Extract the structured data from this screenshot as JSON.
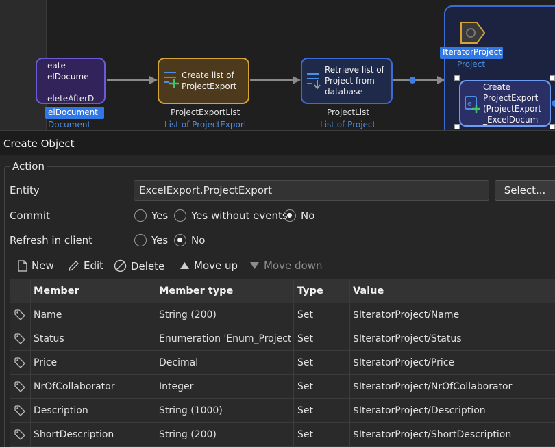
{
  "canvas": {
    "node_excel": {
      "text": "eate\nelDocume\n\neleteAfterD"
    },
    "excel_var": {
      "name": "elDocument",
      "type": "Document"
    },
    "node_create_list": {
      "text": "Create list of\nProjectExport"
    },
    "create_list_var": {
      "name": "ProjectExportList",
      "type": "List of ProjectExport"
    },
    "node_retrieve": {
      "text": "Retrieve list of\nProject from\ndatabase"
    },
    "retrieve_var": {
      "name": "ProjectList",
      "type": "List of Project"
    },
    "iterator": {
      "name": "IteratorProject",
      "type": "Project"
    },
    "node_create_obj": {
      "text": "Create\nProjectExport\n(ProjectExport\n_ExcelDocum"
    }
  },
  "dialog": {
    "title": "Create Object",
    "group_title": "Action",
    "entity_label": "Entity",
    "entity_value": "ExcelExport.ProjectExport",
    "select_button": "Select...",
    "commit_label": "Commit",
    "commit_options": [
      "Yes",
      "Yes without events",
      "No"
    ],
    "commit_selected": "No",
    "refresh_label": "Refresh in client",
    "refresh_options": [
      "Yes",
      "No"
    ],
    "refresh_selected": "No",
    "toolbar": {
      "new": "New",
      "edit": "Edit",
      "delete": "Delete",
      "move_up": "Move up",
      "move_down": "Move down"
    },
    "grid": {
      "columns": [
        "Member",
        "Member type",
        "Type",
        "Value"
      ],
      "rows": [
        [
          "Name",
          "String (200)",
          "Set",
          "$IteratorProject/Name"
        ],
        [
          "Status",
          "Enumeration 'Enum_Project_S...",
          "Set",
          "$IteratorProject/Status"
        ],
        [
          "Price",
          "Decimal",
          "Set",
          "$IteratorProject/Price"
        ],
        [
          "NrOfCollaborator",
          "Integer",
          "Set",
          "$IteratorProject/NrOfCollaborator"
        ],
        [
          "Description",
          "String (1000)",
          "Set",
          "$IteratorProject/Description"
        ],
        [
          "ShortDescription",
          "String (200)",
          "Set",
          "$IteratorProject/ShortDescription"
        ]
      ]
    }
  },
  "colors": {
    "accent_blue": "#2f6fe0",
    "link_blue": "#4f8ee0",
    "node_purple": "#33245c",
    "node_gold_border": "#d4a437"
  }
}
